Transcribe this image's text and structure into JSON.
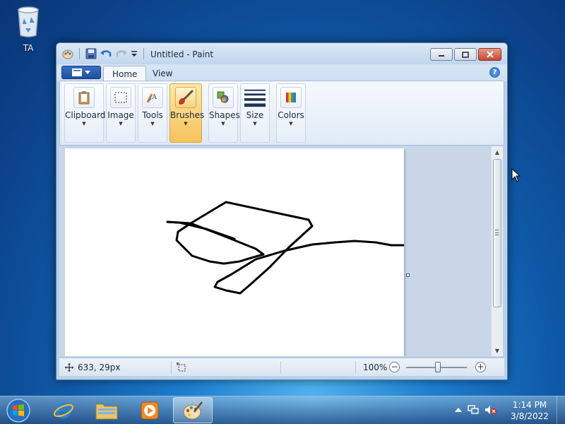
{
  "desktop": {
    "recycle_bin_label": "TA"
  },
  "window": {
    "title": "Untitled - Paint",
    "tabs": [
      {
        "label": "Home",
        "active": true
      },
      {
        "label": "View",
        "active": false
      }
    ],
    "ribbon_groups": [
      {
        "label": "Clipboard",
        "icon": "clipboard-icon"
      },
      {
        "label": "Image",
        "icon": "select-icon"
      },
      {
        "label": "Tools",
        "icon": "tools-icon"
      },
      {
        "label": "Brushes",
        "icon": "brush-icon",
        "active": true
      },
      {
        "label": "Shapes",
        "icon": "shapes-icon"
      },
      {
        "label": "Size",
        "icon": "size-icon"
      },
      {
        "label": "Colors",
        "icon": "colors-icon"
      }
    ],
    "status": {
      "cursor_position": "633, 29px",
      "zoom": "100%",
      "zoom_minus": "−",
      "zoom_plus": "+"
    }
  },
  "taskbar": {
    "clock_time": "1:14 PM",
    "clock_date": "3/8/2022"
  },
  "colors": {
    "accent_window": "#b9d1ea",
    "active_group": "#f7c25b",
    "close_button": "#c6472f"
  }
}
